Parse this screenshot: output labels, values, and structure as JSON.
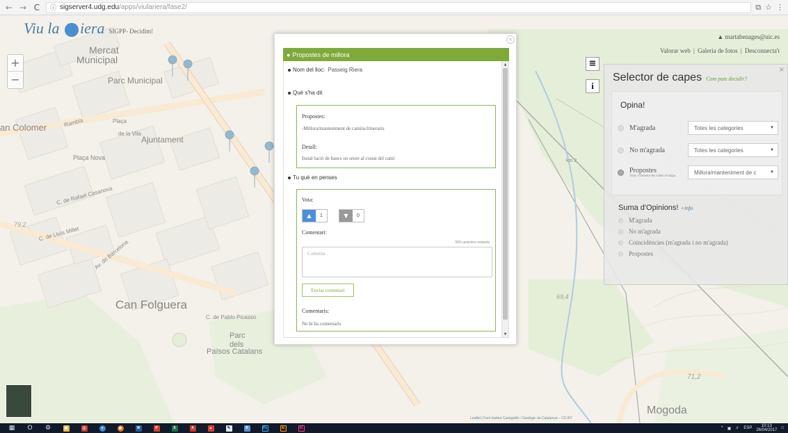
{
  "browser": {
    "back": "←",
    "forward": "→",
    "reload": "C",
    "info_icon": "ⓘ",
    "url_host": "sigserver4.udg.edu",
    "url_path": "/apps/viulariera/fase2/",
    "ext_icons": [
      "⧉",
      "☆",
      "⋮"
    ]
  },
  "header": {
    "logo_text_a": "Viu la",
    "logo_text_b": "iera",
    "subtitle": "SIGPP- Decidim!",
    "user_email": "martabenages@uic.es",
    "links": [
      "Valorar web",
      "|",
      "Galeria de fotos",
      "|",
      "Desconnecta't"
    ]
  },
  "map": {
    "labels": {
      "mercat": "Mercat",
      "municipal": "Municipal",
      "parc_municipal": "Parc Municipal",
      "can_colomer": "an Colomer",
      "rambla": "Rambla",
      "placa": "Plaça",
      "de_la_vila": "de la Vila",
      "ajuntament": "Ajuntament",
      "placa_nova": "Plaça Nova",
      "rafael_casanova": "C. de Rafael Casanova",
      "elev_792": "79,2",
      "lluis_millet": "C. de Lluís Millet",
      "barcelona": "Av. de Barcelona",
      "can_folguera": "Can Folguera",
      "pablo_picasso": "C. de Pablo Picasso",
      "parc": "Parc",
      "dels": "dels",
      "paisos_catalans": "Països Catalans",
      "elev_712": "71,2",
      "elev_694": "69,4",
      "km2": "km 2",
      "mogoda": "Mogoda"
    },
    "attribution": "Leaflet | Font Institut Cartogràfic i Geològic de Catalunya – CC-BY",
    "zoom_in": "+",
    "zoom_out": "−",
    "layers_icon": "≡",
    "info_icon": "i"
  },
  "selector": {
    "title": "Selector de capes",
    "hint": "Com puts decidir?",
    "close": "×",
    "opina": {
      "title": "Opina!",
      "options": [
        {
          "label": "M'agrada",
          "small": "",
          "select": "Totes les categories",
          "checked": false
        },
        {
          "label": "No m'agrada",
          "small": "",
          "select": "Totes les categories",
          "checked": false
        },
        {
          "label": "Propostes",
          "small": "Vota i comenta-les sobre el mapa",
          "select": "Millora/manteniment de c",
          "checked": true
        }
      ]
    },
    "suma": {
      "title": "Suma d'Opinions!",
      "info": "+info",
      "options": [
        "M'agrada",
        "No m'agrada",
        "Coincidències (m'agrada i no m'agrada)",
        "Propostes"
      ]
    }
  },
  "modal": {
    "close": "×",
    "title": "Propostes de millora",
    "nom_label": "Nom del lloc:",
    "nom_value": "Passeig Riera",
    "que_sha_dit": "Què s'ha dit",
    "propostes_label": "Propostes:",
    "propostes_value": "-Millora/manteniment de camins/itineraris",
    "detall_label": "Detall:",
    "detall_value": "Instal·lació de bancs on seure al costat del camí",
    "tu_que_en_penses": "Tu què en penses",
    "vota_label": "Vota:",
    "likes": "1",
    "dislikes": "0",
    "comentari_label": "Comentari:",
    "char_counter": "500 caràcters restants",
    "comment_placeholder": "Comenta",
    "send_button": "Enviar comentari",
    "comentaris_label": "Comentaris:",
    "no_comments": "No hi ha comentaris"
  },
  "taskbar": {
    "time": "10:13",
    "date": "26/04/2017",
    "lang": "ESP",
    "apps": [
      "O",
      "⚙",
      "▣",
      "Ⓐ",
      "●",
      "◉",
      "W",
      "P",
      "X",
      "A",
      "▲",
      "✎",
      "R",
      "Ps",
      "Ai",
      "Id"
    ]
  }
}
